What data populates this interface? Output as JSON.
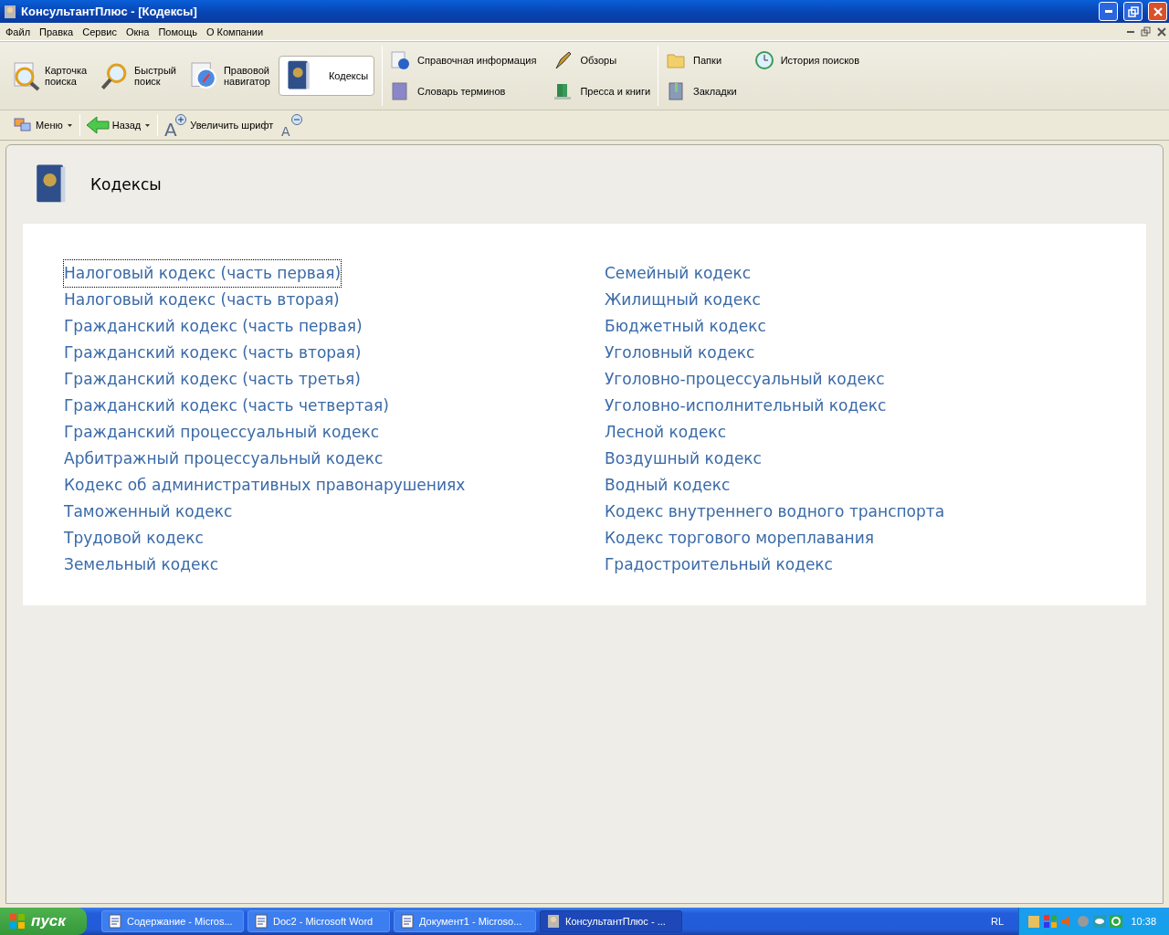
{
  "window": {
    "title": "КонсультантПлюс - [Кодексы]"
  },
  "menu": [
    "Файл",
    "Правка",
    "Сервис",
    "Окна",
    "Помощь",
    "О Компании"
  ],
  "ribbon": {
    "large_buttons": [
      {
        "label": "Карточка\nпоиска",
        "selected": false
      },
      {
        "label": "Быстрый\nпоиск",
        "selected": false
      },
      {
        "label": "Правовой\nнавигатор",
        "selected": false
      },
      {
        "label": "Кодексы",
        "selected": true
      }
    ],
    "groups": [
      [
        "Справочная информация",
        "Словарь терминов",
        "Обзоры",
        "Пресса и книги"
      ],
      [
        "Папки",
        "Закладки",
        "История поисков"
      ]
    ]
  },
  "toolbar": {
    "menu": "Меню",
    "back": "Назад",
    "font_up": "Увеличить шрифт",
    "font_up_glyph": "A",
    "font_down_glyph": "A"
  },
  "page": {
    "title": "Кодексы",
    "columns": [
      [
        {
          "text": "Налоговый кодекс (часть первая)",
          "focused": true
        },
        {
          "text": "Налоговый кодекс (часть вторая)",
          "focused": false
        },
        {
          "text": "Гражданский кодекс (часть первая)",
          "focused": false
        },
        {
          "text": "Гражданский кодекс (часть вторая)",
          "focused": false
        },
        {
          "text": "Гражданский кодекс (часть третья)",
          "focused": false
        },
        {
          "text": "Гражданский кодекс (часть четвертая)",
          "focused": false
        },
        {
          "text": "Гражданский процессуальный кодекс",
          "focused": false
        },
        {
          "text": "Арбитражный процессуальный кодекс",
          "focused": false
        },
        {
          "text": "Кодекс об административных правонарушениях",
          "focused": false
        },
        {
          "text": "Таможенный кодекс",
          "focused": false
        },
        {
          "text": "Трудовой кодекс",
          "focused": false
        },
        {
          "text": "Земельный кодекс",
          "focused": false
        }
      ],
      [
        {
          "text": "Семейный кодекс",
          "focused": false
        },
        {
          "text": "Жилищный кодекс",
          "focused": false
        },
        {
          "text": "Бюджетный кодекс",
          "focused": false
        },
        {
          "text": "Уголовный кодекс",
          "focused": false
        },
        {
          "text": "Уголовно-процессуальный кодекс",
          "focused": false
        },
        {
          "text": "Уголовно-исполнительный кодекс",
          "focused": false
        },
        {
          "text": "Лесной кодекс",
          "focused": false
        },
        {
          "text": "Воздушный кодекс",
          "focused": false
        },
        {
          "text": "Водный кодекс",
          "focused": false
        },
        {
          "text": "Кодекс внутреннего водного транспорта",
          "focused": false
        },
        {
          "text": "Кодекс торгового мореплавания",
          "focused": false
        },
        {
          "text": "Градостроительный кодекс",
          "focused": false
        }
      ]
    ]
  },
  "taskbar": {
    "start": "пуск",
    "tasks": [
      {
        "label": "Содержание - Micros...",
        "kind": "word",
        "selected": false
      },
      {
        "label": "Doc2 - Microsoft Word",
        "kind": "word",
        "selected": false
      },
      {
        "label": "Документ1 - Microso...",
        "kind": "word",
        "selected": false
      },
      {
        "label": "КонсультантПлюс - ...",
        "kind": "consultant",
        "selected": true
      }
    ],
    "language": "RL",
    "clock": "10:38"
  }
}
